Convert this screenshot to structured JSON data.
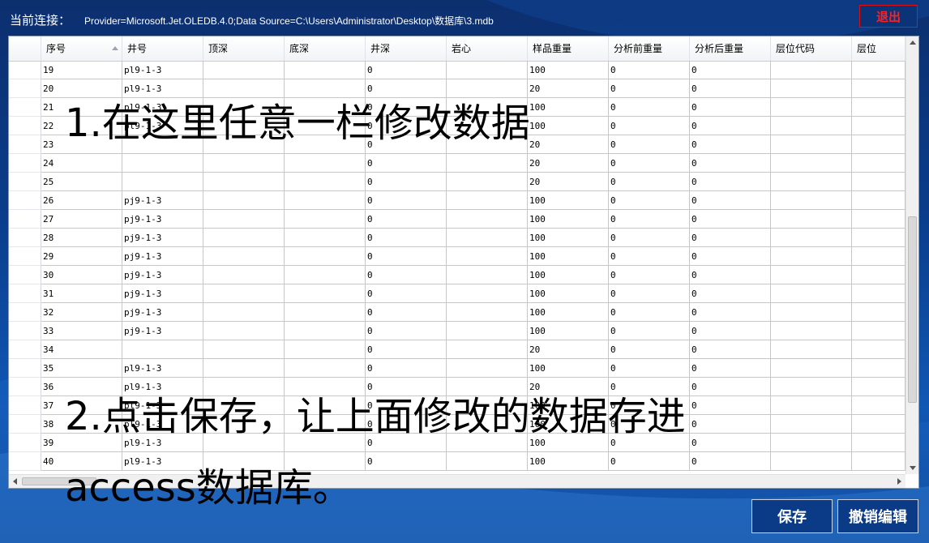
{
  "header": {
    "connection_label": "当前连接：",
    "connection_string": "Provider=Microsoft.Jet.OLEDB.4.0;Data Source=C:\\Users\\Administrator\\Desktop\\数据库\\3.mdb",
    "exit_label": "退出"
  },
  "grid": {
    "columns": [
      "序号",
      "井号",
      "顶深",
      "底深",
      "井深",
      "岩心",
      "样品重量",
      "分析前重量",
      "分析后重量",
      "层位代码",
      "层位"
    ],
    "sorted_column": "序号",
    "rows": [
      [
        "19",
        "pl9-1-3",
        "",
        "",
        "0",
        "",
        "100",
        "0",
        "0",
        "",
        ""
      ],
      [
        "20",
        "pl9-1-3",
        "",
        "",
        "0",
        "",
        "20",
        "0",
        "0",
        "",
        ""
      ],
      [
        "21",
        "pl9-1-3",
        "",
        "",
        "0",
        "",
        "100",
        "0",
        "0",
        "",
        ""
      ],
      [
        "22",
        "pl9-1-3",
        "",
        "",
        "0",
        "",
        "100",
        "0",
        "0",
        "",
        ""
      ],
      [
        "23",
        "",
        "",
        "",
        "0",
        "",
        "20",
        "0",
        "0",
        "",
        ""
      ],
      [
        "24",
        "",
        "",
        "",
        "0",
        "",
        "20",
        "0",
        "0",
        "",
        ""
      ],
      [
        "25",
        "",
        "",
        "",
        "0",
        "",
        "20",
        "0",
        "0",
        "",
        ""
      ],
      [
        "26",
        "pj9-1-3",
        "",
        "",
        "0",
        "",
        "100",
        "0",
        "0",
        "",
        ""
      ],
      [
        "27",
        "pj9-1-3",
        "",
        "",
        "0",
        "",
        "100",
        "0",
        "0",
        "",
        ""
      ],
      [
        "28",
        "pj9-1-3",
        "",
        "",
        "0",
        "",
        "100",
        "0",
        "0",
        "",
        ""
      ],
      [
        "29",
        "pj9-1-3",
        "",
        "",
        "0",
        "",
        "100",
        "0",
        "0",
        "",
        ""
      ],
      [
        "30",
        "pj9-1-3",
        "",
        "",
        "0",
        "",
        "100",
        "0",
        "0",
        "",
        ""
      ],
      [
        "31",
        "pj9-1-3",
        "",
        "",
        "0",
        "",
        "100",
        "0",
        "0",
        "",
        ""
      ],
      [
        "32",
        "pj9-1-3",
        "",
        "",
        "0",
        "",
        "100",
        "0",
        "0",
        "",
        ""
      ],
      [
        "33",
        "pj9-1-3",
        "",
        "",
        "0",
        "",
        "100",
        "0",
        "0",
        "",
        ""
      ],
      [
        "34",
        "",
        "",
        "",
        "0",
        "",
        "20",
        "0",
        "0",
        "",
        ""
      ],
      [
        "35",
        "pl9-1-3",
        "",
        "",
        "0",
        "",
        "100",
        "0",
        "0",
        "",
        ""
      ],
      [
        "36",
        "pl9-1-3",
        "",
        "",
        "0",
        "",
        "20",
        "0",
        "0",
        "",
        ""
      ],
      [
        "37",
        "pl9-1-3",
        "",
        "",
        "0",
        "",
        "100",
        "0",
        "0",
        "",
        ""
      ],
      [
        "38",
        "pl9-1-3",
        "",
        "",
        "0",
        "",
        "100",
        "0",
        "0",
        "",
        ""
      ],
      [
        "39",
        "pl9-1-3",
        "",
        "",
        "0",
        "",
        "100",
        "0",
        "0",
        "",
        ""
      ],
      [
        "40",
        "pl9-1-3",
        "",
        "",
        "0",
        "",
        "100",
        "0",
        "0",
        "",
        ""
      ]
    ]
  },
  "annotations": {
    "step1": "1.在这里任意一栏修改数据",
    "step2_line1": "2.点击保存，让上面修改的数据存进",
    "step2_line2": "access数据库。"
  },
  "buttons": {
    "save_label": "保存",
    "undo_label": "撤销编辑"
  },
  "colors": {
    "background": "#0a3d8c",
    "exit_text": "#ff2020",
    "button_bg": "#0b3a86"
  }
}
